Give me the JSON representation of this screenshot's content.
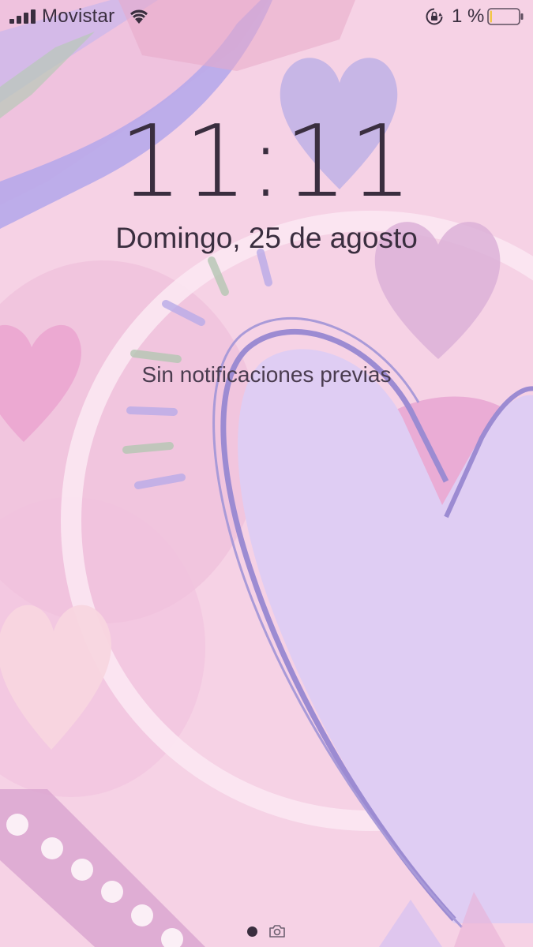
{
  "status_bar": {
    "carrier": "Movistar",
    "battery_percent": "1 %",
    "battery_level": 0.01,
    "icons": [
      "signal-icon",
      "wifi-icon",
      "rotation-lock-icon",
      "battery-icon"
    ]
  },
  "lock_screen": {
    "time": "11:11",
    "date": "Domingo, 25 de agosto",
    "notifications_text": "Sin notificaciones previas"
  },
  "page_indicator": {
    "pages": [
      "home-dot",
      "camera-icon"
    ],
    "current": 0
  },
  "colors": {
    "text": "#3a2e3f",
    "wallpaper_base": "#f7d3e6",
    "heart_lavender": "#dfcdf3",
    "accent_purple": "#9b8ad0",
    "accent_pink": "#e9a6d2"
  }
}
